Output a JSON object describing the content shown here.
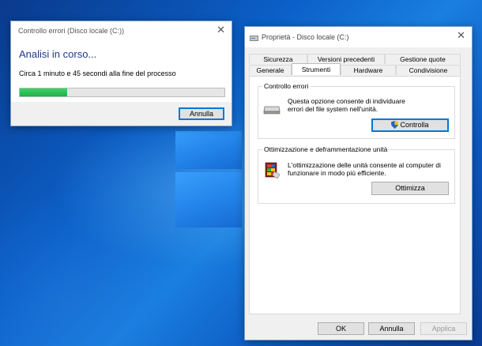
{
  "check_dialog": {
    "title": "Controllo errori (Disco locale (C:))",
    "heading": "Analisi in corso...",
    "info": "Circa 1 minuto e 45 secondi alla fine del processo",
    "progress": 0.23,
    "cancel_label": "Annulla",
    "close_icon": "close-icon"
  },
  "properties_dialog": {
    "title": "Proprietà - Disco locale (C:)",
    "tabs_row1": [
      "Sicurezza",
      "Versioni precedenti",
      "Gestione quote"
    ],
    "tabs_row2": [
      "Generale",
      "Strumenti",
      "Hardware",
      "Condivisione"
    ],
    "active_tab": "Strumenti",
    "error_check": {
      "group_label": "Controllo errori",
      "line1": "Questa opzione consente di individuare",
      "line2": "errori del file system nell'unità.",
      "button_label": "Controlla",
      "icon": "hard-drive-icon"
    },
    "optimize": {
      "group_label": "Ottimizzazione e deframmentazione unità",
      "line1": "L'ottimizzazione delle unità consente al computer di",
      "line2": "funzionare in modo più efficiente.",
      "button_label": "Ottimizza",
      "icon": "defrag-icon"
    },
    "ok_label": "OK",
    "cancel_label": "Annulla",
    "apply_label": "Applica"
  }
}
